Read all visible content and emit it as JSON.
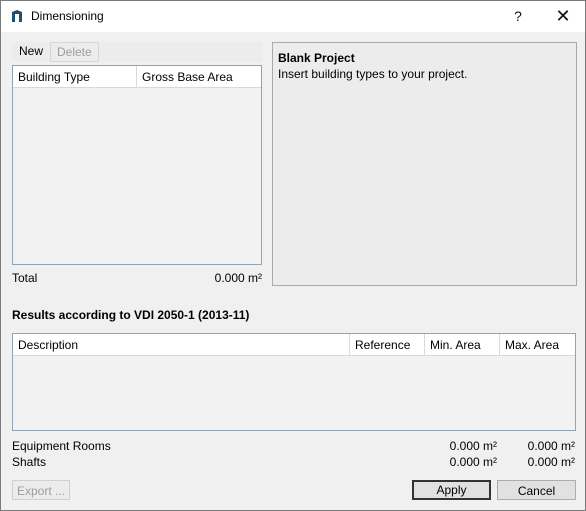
{
  "window": {
    "title": "Dimensioning",
    "help": "?",
    "close": "✕"
  },
  "toolbar": {
    "new": "New",
    "delete": "Delete"
  },
  "building_table": {
    "columns": [
      "Building Type",
      "Gross Base Area"
    ],
    "rows": []
  },
  "total": {
    "label": "Total",
    "value": "0.000 m²"
  },
  "info": {
    "title": "Blank Project",
    "text": "Insert building types to your project."
  },
  "results": {
    "title": "Results according to VDI 2050-1 (2013-11)",
    "columns": [
      "Description",
      "Reference",
      "Min. Area",
      "Max. Area"
    ],
    "rows": []
  },
  "summary": [
    {
      "label": "Equipment Rooms",
      "min": "0.000 m²",
      "max": "0.000 m²"
    },
    {
      "label": "Shafts",
      "min": "0.000 m²",
      "max": "0.000 m²"
    }
  ],
  "buttons": {
    "export": "Export ...",
    "apply": "Apply",
    "cancel": "Cancel"
  }
}
